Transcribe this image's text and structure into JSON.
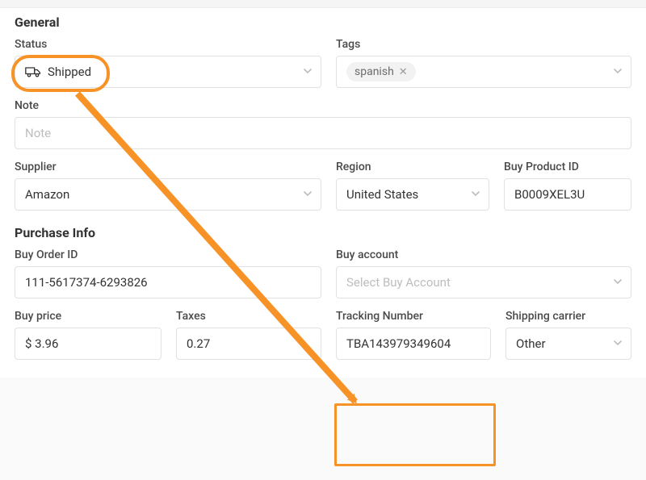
{
  "sections": {
    "general": "General",
    "purchase_info": "Purchase Info"
  },
  "general": {
    "status": {
      "label": "Status",
      "value": "Shipped"
    },
    "tags": {
      "label": "Tags",
      "items": [
        "spanish"
      ]
    },
    "note": {
      "label": "Note",
      "placeholder": "Note"
    },
    "supplier": {
      "label": "Supplier",
      "value": "Amazon"
    },
    "region": {
      "label": "Region",
      "value": "United States"
    },
    "buy_product_id": {
      "label": "Buy Product ID",
      "value": "B0009XEL3U"
    }
  },
  "purchase": {
    "buy_order_id": {
      "label": "Buy Order ID",
      "value": "111-5617374-6293826"
    },
    "buy_account": {
      "label": "Buy account",
      "placeholder": "Select Buy Account"
    },
    "buy_price": {
      "label": "Buy price",
      "value": "$ 3.96"
    },
    "taxes": {
      "label": "Taxes",
      "value": "0.27"
    },
    "tracking_number": {
      "label": "Tracking Number",
      "value": "TBA143979349604"
    },
    "shipping_carrier": {
      "label": "Shipping carrier",
      "value": "Other"
    }
  },
  "annotations": {
    "color": "#F79226"
  }
}
